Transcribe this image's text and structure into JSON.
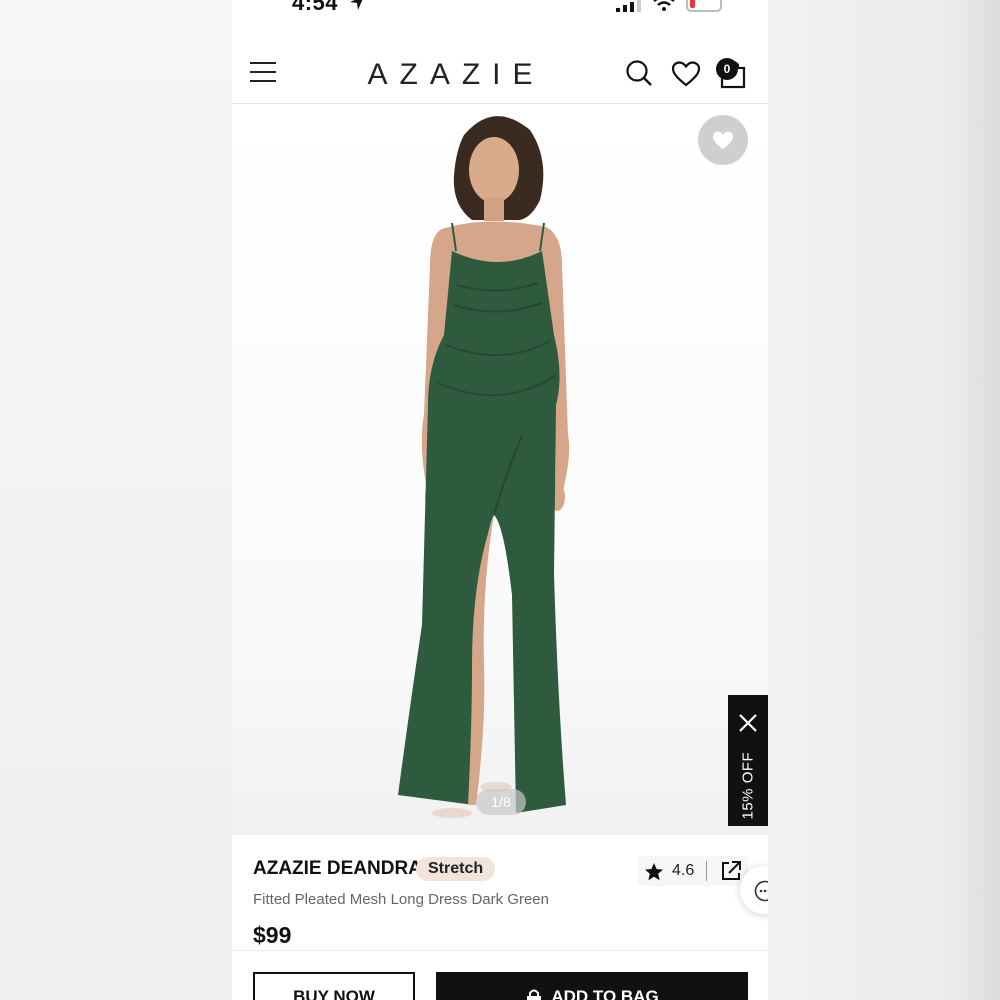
{
  "status_bar": {
    "time": "4:54"
  },
  "header": {
    "brand": "AZAZIE",
    "cart_count": "0"
  },
  "gallery": {
    "counter": "1/8",
    "promo": "15% OFF"
  },
  "product": {
    "name": "AZAZIE DEANDRA",
    "badge": "Stretch",
    "rating": "4.6",
    "description": "Fitted Pleated Mesh Long Dress Dark Green",
    "price": "$99"
  },
  "actions": {
    "buy_now": "BUY NOW",
    "add_to_bag": "ADD TO BAG"
  },
  "colors": {
    "dress": "#2e5a3e",
    "accent_badge": "#f2e4d8",
    "button_dark": "#111111"
  },
  "icons": [
    "menu-icon",
    "search-icon",
    "heart-icon",
    "bag-icon",
    "star-icon",
    "share-icon",
    "close-icon",
    "chat-icon",
    "lock-icon"
  ]
}
